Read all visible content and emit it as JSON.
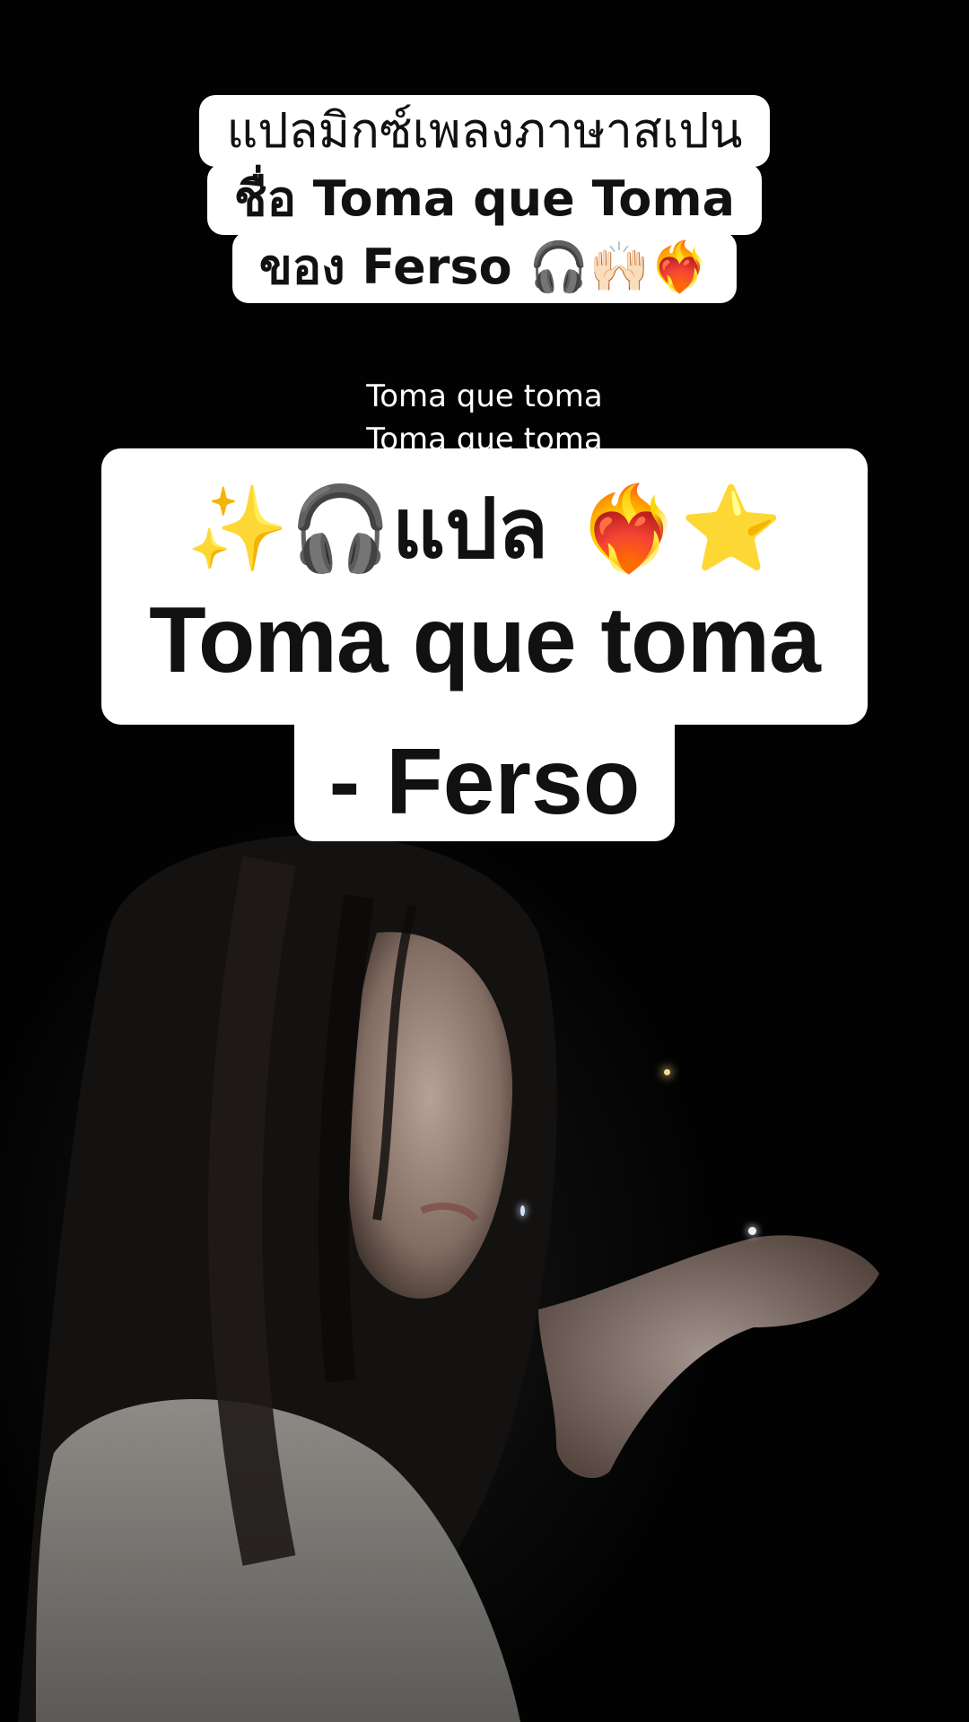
{
  "top_caption": {
    "line1": "แปลมิกซ์เพลงภาษาสเปน",
    "line2": "ชื่อ Toma que Toma",
    "line3": "ของ Ferso 🎧🙌🏻❤️‍🔥"
  },
  "lyrics": {
    "line1": "Toma que toma",
    "line2": "Toma que toma"
  },
  "main_card": {
    "line1": "✨🎧แปล ❤️‍🔥⭐",
    "line2": "Toma que toma",
    "line3": "- Ferso"
  },
  "colors": {
    "background": "#000000",
    "caption_bg": "#ffffff",
    "caption_text": "#111111",
    "lyrics_text": "#ffffff"
  }
}
